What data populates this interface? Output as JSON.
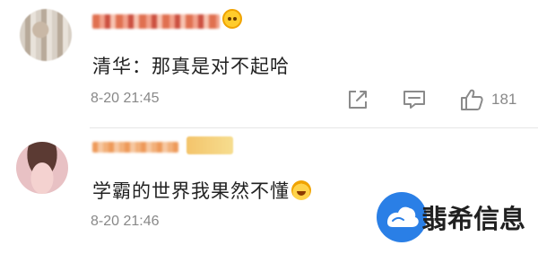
{
  "comments": [
    {
      "text": "清华：那真是对不起哈",
      "time": "8-20 21:45",
      "like_count": "181"
    },
    {
      "text": "学霸的世界我果然不懂",
      "time": "8-20 21:46"
    }
  ],
  "icons": {
    "forward": "share-square-icon",
    "reply": "comment-bubble-icon",
    "like": "thumbs-up-icon",
    "emoji": "smiling-emoji"
  },
  "watermark": {
    "text": "翡希信息"
  },
  "colors": {
    "text": "#222222",
    "meta": "#888888",
    "icon": "#8a8a8a",
    "watermark_blue": "#2a7fe6"
  }
}
